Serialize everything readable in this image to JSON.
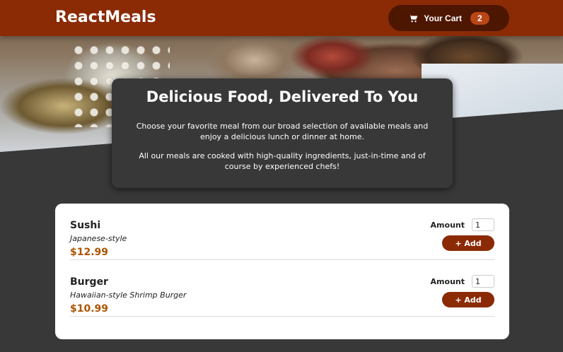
{
  "header": {
    "brand": "ReactMeals",
    "cart_label": "Your Cart",
    "cart_count": "2"
  },
  "summary": {
    "title": "Delicious Food, Delivered To You",
    "paragraph_1": "Choose your favorite meal from our broad selection of available meals and enjoy a delicious lunch or dinner at home.",
    "paragraph_2": "All our meals are cooked with high-quality ingredients, just-in-time and of course by experienced chefs!"
  },
  "meals": [
    {
      "name": "Sushi",
      "description": "Japanese-style",
      "price": "$12.99",
      "amount_label": "Amount",
      "amount_value": "1",
      "add_label": "+ Add"
    },
    {
      "name": "Burger",
      "description": "Hawaiian-style Shrimp Burger",
      "price": "$10.99",
      "amount_label": "Amount",
      "amount_value": "1",
      "add_label": "+ Add"
    }
  ],
  "colors": {
    "header_bg": "#8a2b06",
    "cart_button_bg": "#4d1601",
    "badge_bg": "#b94517",
    "price": "#ad5502",
    "page_bg": "#383838"
  },
  "icons": {
    "cart": "cart-icon"
  }
}
